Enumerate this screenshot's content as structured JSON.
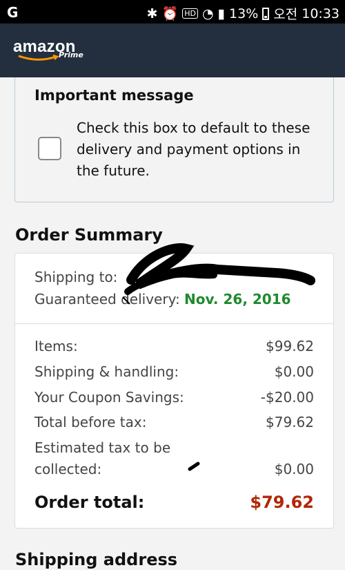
{
  "status_bar": {
    "carrier_icon": "G",
    "battery": "13%",
    "period": "오전",
    "time": "10:33"
  },
  "header": {
    "logo_word": "amazon",
    "logo_prime": "Prime"
  },
  "important_message": {
    "title": "Important message",
    "text": "Check this box to default to these delivery and payment options in the future.",
    "checked": false
  },
  "order_summary": {
    "title": "Order Summary",
    "shipping_to_label": "Shipping to:",
    "guaranteed_label": "Guaranteed delivery:",
    "guaranteed_date": "Nov. 26, 2016",
    "rows": [
      {
        "label": "Items:",
        "value": "$99.62"
      },
      {
        "label": "Shipping & handling:",
        "value": "$0.00"
      },
      {
        "label": "Your Coupon Savings:",
        "value": "-$20.00"
      },
      {
        "label": "Total before tax:",
        "value": "$79.62"
      },
      {
        "label": "Estimated tax to be collected:",
        "value": "$0.00"
      }
    ],
    "total_label": "Order total:",
    "total_value": "$79.62",
    "total_color": "#b12704",
    "date_color": "#1e8a2e"
  },
  "shipping_address": {
    "title": "Shipping address"
  }
}
